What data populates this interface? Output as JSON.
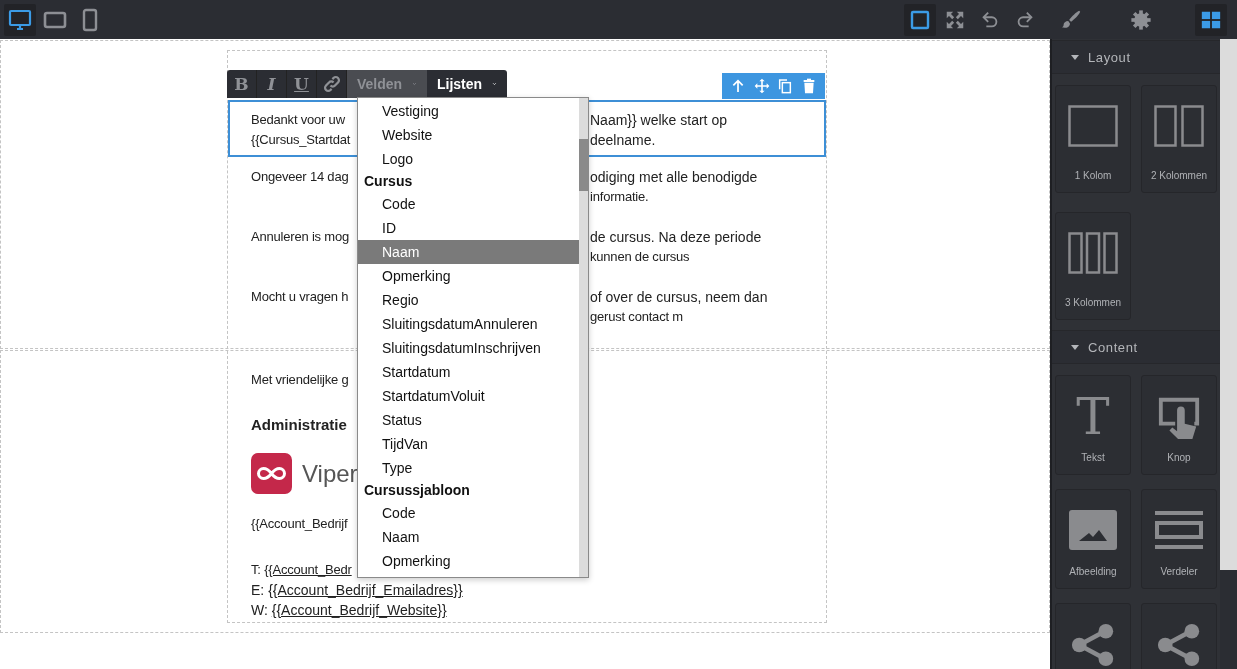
{
  "toolbar": {
    "devices": [
      {
        "kind": "desktop",
        "selected": true
      },
      {
        "kind": "tablet",
        "selected": false
      },
      {
        "kind": "phone",
        "selected": false
      }
    ],
    "outline": {
      "on": true
    },
    "actions": [
      {
        "kind": "fullscreen"
      },
      {
        "kind": "undo"
      },
      {
        "kind": "redo"
      }
    ],
    "panel_tabs": [
      {
        "kind": "style",
        "selected": false
      },
      {
        "kind": "settings",
        "selected": false
      },
      {
        "kind": "blocks",
        "selected": true
      }
    ]
  },
  "canvas": {
    "format_bar": {
      "buttons": [
        {
          "kind": "text",
          "label": "B"
        },
        {
          "kind": "text",
          "label": "I"
        },
        {
          "kind": "text",
          "label": "U"
        },
        {
          "kind": "link"
        }
      ],
      "menus": [
        {
          "label": "Velden",
          "open": true
        },
        {
          "label": "Lijsten",
          "open": false
        }
      ]
    },
    "block_tools": [
      {
        "kind": "up"
      },
      {
        "kind": "move"
      },
      {
        "kind": "copy"
      },
      {
        "kind": "delete"
      }
    ],
    "blocks": [
      {
        "selected": true,
        "paragraphs": [
          [
            {
              "left": "Bedankt voor uw",
              "right": "Naam}} welke start op"
            },
            {
              "left": "{{Cursus_Startdat",
              "right": "deelname."
            }
          ]
        ]
      },
      {
        "selected": false,
        "paragraphs": [
          [
            {
              "left": "Ongeveer 14 dag",
              "right": "odiging met alle benodigde"
            },
            {
              "left": "informatie."
            }
          ],
          [
            {
              "left": "Annuleren is mog",
              "right": "de cursus. Na deze periode"
            },
            {
              "left": "kunnen de cursus"
            }
          ],
          [
            {
              "left": "Mocht u vragen h",
              "right": "of over de cursus, neem dan"
            },
            {
              "left": "gerust contact m"
            }
          ]
        ]
      }
    ],
    "signature": {
      "greeting": "Met vriendelijke g",
      "sender": "Administratie",
      "logo_text": "Viper",
      "company": "{{Account_Bedrijf",
      "contacts": [
        {
          "prefix": "T:",
          "link": "{{Account_Bedr"
        },
        {
          "prefix": "E:",
          "link": "{{Account_Bedrijf_Emailadres}}"
        },
        {
          "prefix": "W:",
          "link": "{{Account_Bedrijf_Website}}"
        }
      ]
    },
    "field_menu": {
      "items": [
        {
          "kind": "field",
          "label": "Vestiging",
          "selected": false
        },
        {
          "kind": "field",
          "label": "Website",
          "selected": false
        },
        {
          "kind": "field",
          "label": "Logo",
          "selected": false
        },
        {
          "kind": "group",
          "label": "Cursus",
          "children": [
            {
              "kind": "field",
              "label": "Code",
              "selected": false
            },
            {
              "kind": "field",
              "label": "ID",
              "selected": false
            },
            {
              "kind": "field",
              "label": "Naam",
              "selected": true
            },
            {
              "kind": "field",
              "label": "Opmerking",
              "selected": false
            },
            {
              "kind": "field",
              "label": "Regio",
              "selected": false
            },
            {
              "kind": "field",
              "label": "SluitingsdatumAnnuleren",
              "selected": false
            },
            {
              "kind": "field",
              "label": "SluitingsdatumInschrijven",
              "selected": false
            },
            {
              "kind": "field",
              "label": "Startdatum",
              "selected": false
            },
            {
              "kind": "field",
              "label": "StartdatumVoluit",
              "selected": false
            },
            {
              "kind": "field",
              "label": "Status",
              "selected": false
            },
            {
              "kind": "field",
              "label": "TijdVan",
              "selected": false
            },
            {
              "kind": "field",
              "label": "Type",
              "selected": false
            }
          ]
        },
        {
          "kind": "group",
          "label": "Cursussjabloon",
          "children": [
            {
              "kind": "field",
              "label": "Code",
              "selected": false
            },
            {
              "kind": "field",
              "label": "Naam",
              "selected": false
            },
            {
              "kind": "field",
              "label": "Opmerking",
              "selected": false
            }
          ]
        }
      ]
    }
  },
  "sidebar": {
    "sections": [
      {
        "title": "Layout",
        "expanded": true,
        "blocks": [
          {
            "kind": "col1",
            "label": "1 Kolom"
          },
          {
            "kind": "col2",
            "label": "2 Kolommen"
          },
          {
            "kind": "col3",
            "label": "3 Kolommen"
          }
        ]
      },
      {
        "title": "Content",
        "expanded": true,
        "blocks": [
          {
            "kind": "text",
            "glyph": "T",
            "label": "Tekst"
          },
          {
            "kind": "button",
            "label": "Knop"
          },
          {
            "kind": "image",
            "label": "Afbeelding"
          },
          {
            "kind": "divider",
            "label": "Verdeler"
          },
          {
            "kind": "share"
          },
          {
            "kind": "share"
          }
        ]
      }
    ]
  }
}
